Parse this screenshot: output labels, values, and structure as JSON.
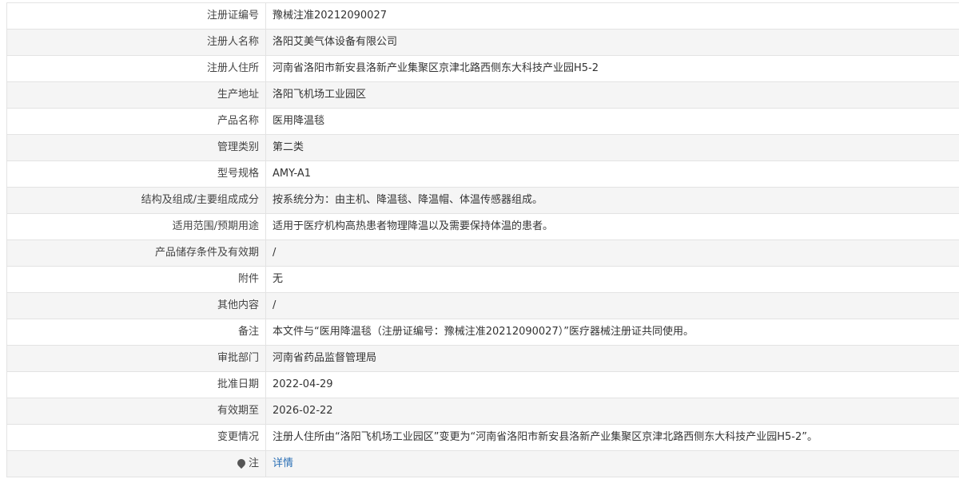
{
  "rows": [
    {
      "label": "注册证编号",
      "value": "豫械注准20212090027"
    },
    {
      "label": "注册人名称",
      "value": "洛阳艾美气体设备有限公司"
    },
    {
      "label": "注册人住所",
      "value": "河南省洛阳市新安县洛新产业集聚区京津北路西侧东大科技产业园H5-2"
    },
    {
      "label": "生产地址",
      "value": "洛阳飞机场工业园区"
    },
    {
      "label": "产品名称",
      "value": "医用降温毯"
    },
    {
      "label": "管理类别",
      "value": "第二类"
    },
    {
      "label": "型号规格",
      "value": "AMY-A1"
    },
    {
      "label": "结构及组成/主要组成成分",
      "value": "按系统分为：由主机、降温毯、降温帽、体温传感器组成。"
    },
    {
      "label": "适用范围/预期用途",
      "value": "适用于医疗机构高热患者物理降温以及需要保持体温的患者。"
    },
    {
      "label": "产品储存条件及有效期",
      "value": "/"
    },
    {
      "label": "附件",
      "value": "无"
    },
    {
      "label": "其他内容",
      "value": "/"
    },
    {
      "label": "备注",
      "value": "本文件与“医用降温毯（注册证编号：豫械注准20212090027）”医疗器械注册证共同使用。"
    },
    {
      "label": "审批部门",
      "value": "河南省药品监督管理局"
    },
    {
      "label": "批准日期",
      "value": "2022-04-29"
    },
    {
      "label": "有效期至",
      "value": "2026-02-22"
    },
    {
      "label": "变更情况",
      "value": "注册人住所由“洛阳飞机场工业园区”变更为“河南省洛阳市新安县洛新产业集聚区京津北路西侧东大科技产业园H5-2”。"
    }
  ],
  "note": {
    "label": "注",
    "icon": "pin-icon",
    "link_text": "详情"
  }
}
